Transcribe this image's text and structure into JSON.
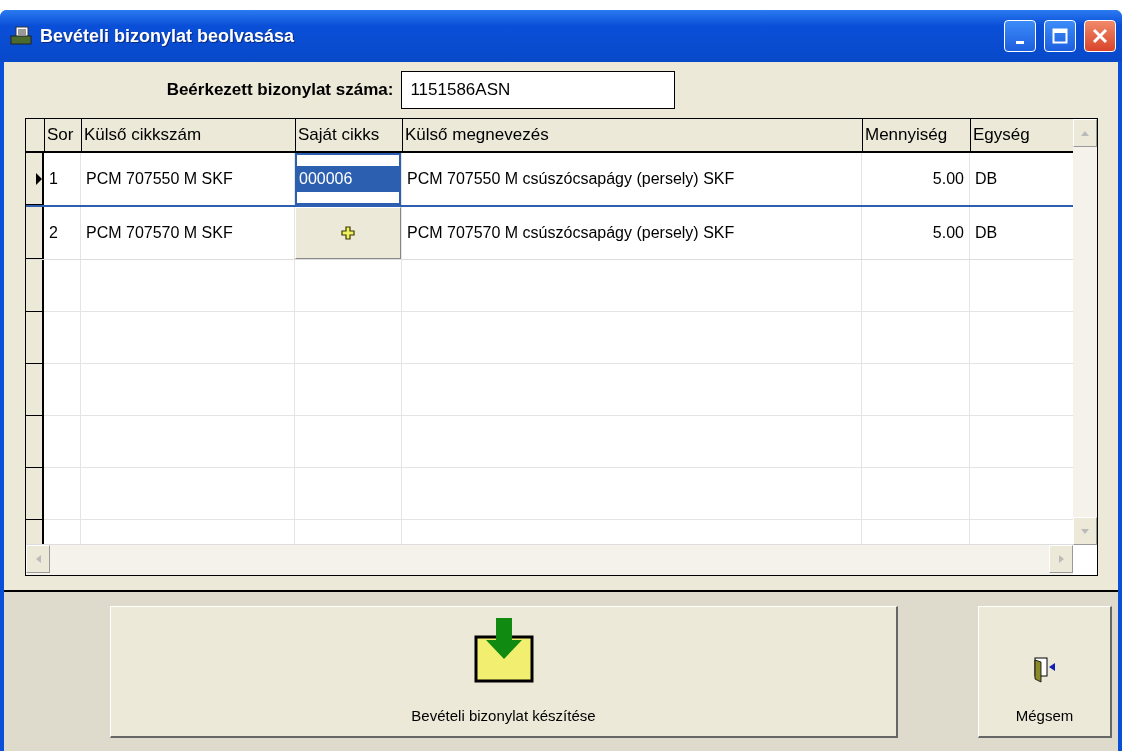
{
  "window": {
    "title": "Bevételi bizonylat beolvasása"
  },
  "document_number": {
    "label": "Beérkezett bizonylat száma:",
    "value": "1151586ASN"
  },
  "table": {
    "columns": [
      "Sor",
      "Külső cikkszám",
      "Saját cikks",
      "Külső megnevezés",
      "Mennyiség",
      "Egység"
    ],
    "rows": [
      {
        "selected": true,
        "row": "1",
        "external_code": "PCM 707550 M SKF",
        "own_code": {
          "kind": "editor",
          "value": "000006"
        },
        "external_name": "PCM 707550 M csúszócsapágy (persely)  SKF",
        "quantity": "5.00",
        "unit": "DB"
      },
      {
        "selected": false,
        "row": "2",
        "external_code": "PCM 707570 M SKF",
        "own_code": {
          "kind": "add-button"
        },
        "external_name": "PCM 707570 M csúszócsapágy (persely)  SKF",
        "quantity": "5.00",
        "unit": "DB"
      }
    ]
  },
  "buttons": [
    {
      "kind": "create",
      "label": "Bevételi bizonylat készítése"
    },
    {
      "kind": "cancel",
      "label": "Mégsem"
    }
  ]
}
